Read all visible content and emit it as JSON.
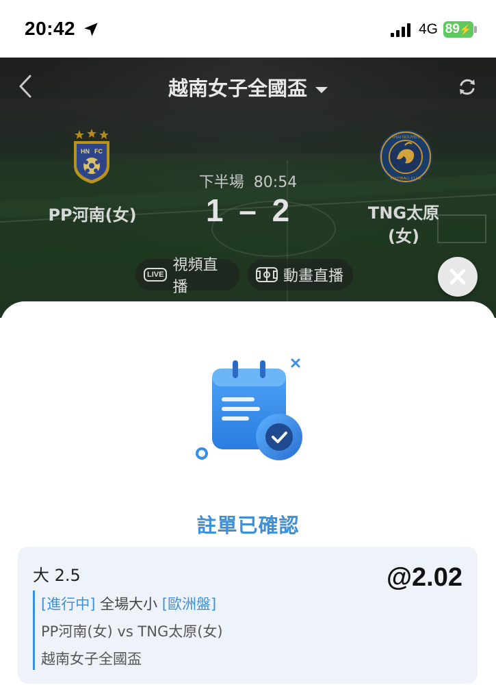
{
  "status_bar": {
    "time": "20:42",
    "network": "4G",
    "battery": "89",
    "battery_color": "#5fc95f"
  },
  "match": {
    "league_title": "越南女子全國盃",
    "period": "下半場",
    "clock": "80:54",
    "home_team": "PP河南(女)",
    "away_team_line1": "TNG太原",
    "away_team_line2": "(女)",
    "home_score": "1",
    "score_separator": "–",
    "away_score": "2",
    "home_crest_text": "HN FC",
    "away_crest_text": "THAI NGUYEN T&T FOOTBALL CLUB",
    "video_badge": "LIVE",
    "video_label": "視頻直播",
    "animation_label": "動畫直播"
  },
  "sheet": {
    "confirm_title": "註單已確認",
    "accent_color": "#3d8fd6"
  },
  "bet": {
    "selection": "大 2.5",
    "odds": "@2.02",
    "status_tag": "[進行中]",
    "market": "全場大小",
    "odds_type_tag": "[歐洲盤]",
    "fixture": "PP河南(女) vs TNG太原(女)",
    "competition": "越南女子全國盃"
  },
  "icons": [
    "location-arrow-icon",
    "signal-icon",
    "back-chevron-icon",
    "dropdown-caret-icon",
    "refresh-icon",
    "pitch-icon",
    "close-icon",
    "calendar-check-icon"
  ]
}
